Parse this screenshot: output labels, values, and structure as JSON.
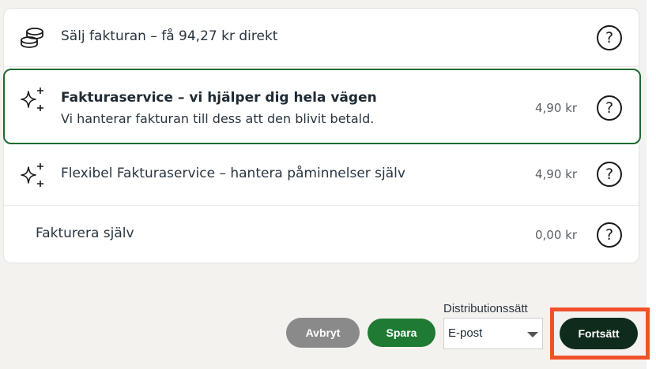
{
  "options": [
    {
      "label": "Sälj fakturan – få 94,27 kr direkt",
      "sublabel": "",
      "price": "",
      "icon": "coins-icon",
      "help": "?"
    },
    {
      "label": "Fakturaservice – vi hjälper dig hela vägen",
      "sublabel": "Vi hanterar fakturan till dess att den blivit betald.",
      "price": "4,90 kr",
      "icon": "sparkles-icon",
      "help": "?",
      "selected": true
    },
    {
      "label": "Flexibel Fakturaservice – hantera påminnelser själv",
      "sublabel": "",
      "price": "4,90 kr",
      "icon": "sparkles-icon",
      "help": "?"
    },
    {
      "label": "Fakturera själv",
      "sublabel": "",
      "price": "0,00 kr",
      "icon": "",
      "help": "?"
    }
  ],
  "footer": {
    "cancel_label": "Avbryt",
    "save_label": "Spara",
    "distribution_label": "Distributionssätt",
    "distribution_value": "E-post",
    "continue_label": "Fortsätt"
  },
  "colors": {
    "selected_border": "#1d6b2e",
    "cancel_bg": "#8a8a8a",
    "save_bg": "#1f7a34",
    "continue_bg": "#0e2b1c",
    "highlight": "#f0512a"
  }
}
